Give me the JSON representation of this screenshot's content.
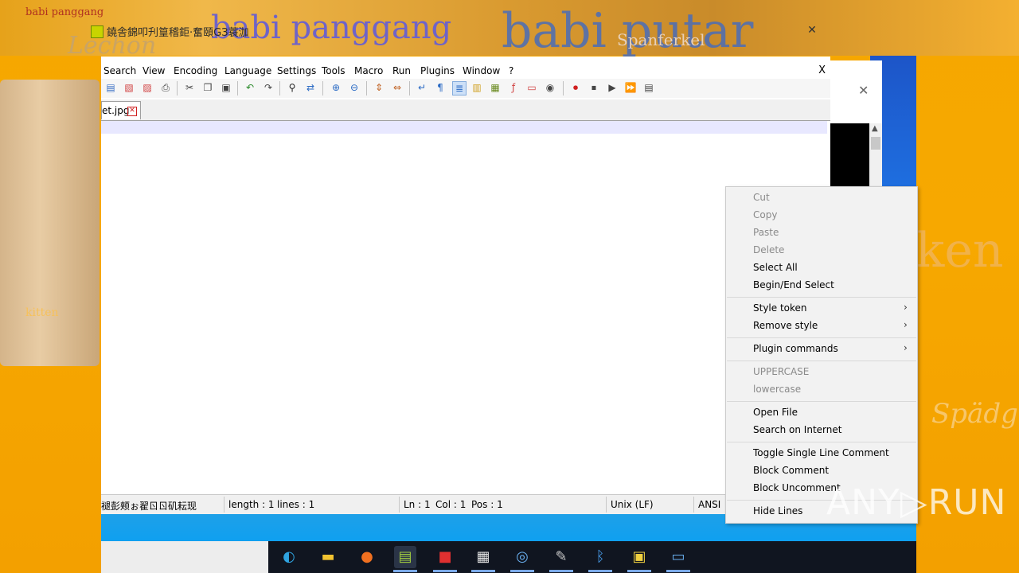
{
  "background": {
    "words": [
      "babi panggang",
      "babi putar",
      "Spanferkel",
      "babi panggang",
      "kitten",
      "Spädgris",
      "Lechon"
    ],
    "accent_color": "#f5a700"
  },
  "window": {
    "title": "鐃舎錦叩刋篁稽鉅·奮頤GЗ蓑泇",
    "close_glyph": "✕"
  },
  "menu": {
    "items": [
      "Search",
      "View",
      "Encoding",
      "Language",
      "Settings",
      "Tools",
      "Macro",
      "Run",
      "Plugins",
      "Window",
      "?"
    ],
    "close": "X"
  },
  "toolbar": {
    "icons": [
      "new-file-icon",
      "open-file-icon",
      "save-icon",
      "save-all-icon",
      "print-icon",
      "cut-icon",
      "copy-icon",
      "paste-icon",
      "undo-icon",
      "redo-icon",
      "find-icon",
      "replace-icon",
      "zoom-in-icon",
      "zoom-out-icon",
      "sync-v-icon",
      "sync-h-icon",
      "word-wrap-icon",
      "all-chars-icon",
      "indent-guide-icon",
      "udl-icon",
      "doc-map-icon",
      "function-list-icon",
      "folder-workspace-icon",
      "monitor-icon",
      "record-icon",
      "stop-icon",
      "play-icon",
      "run-multiple-icon",
      "save-macro-icon"
    ]
  },
  "tab": {
    "label": "et.jpg",
    "close_glyph": "✕"
  },
  "status": {
    "doc_type": "褪彭颊ぉ翟ㄖㄖ矶耘现",
    "length": "length : 1",
    "lines": "lines : 1",
    "ln": "Ln : 1",
    "col": "Col : 1",
    "pos": "Pos : 1",
    "eol": "Unix (LF)",
    "encoding": "ANSI"
  },
  "context_menu": {
    "cut": "Cut",
    "copy": "Copy",
    "paste": "Paste",
    "delete": "Delete",
    "select_all": "Select All",
    "begin_end_select": "Begin/End Select",
    "style_token": "Style token",
    "remove_style": "Remove style",
    "plugin_commands": "Plugin commands",
    "uppercase": "UPPERCASE",
    "lowercase": "lowercase",
    "open_file": "Open File",
    "search_on_internet": "Search on Internet",
    "toggle_comment": "Toggle Single Line Comment",
    "block_comment": "Block Comment",
    "block_uncomment": "Block Uncomment",
    "hide_lines": "Hide Lines",
    "submenu_arrow": "›"
  },
  "dialog": {
    "close_glyph": "✕"
  },
  "taskbar": {
    "apps": [
      "edge-icon",
      "file-explorer-icon",
      "firefox-icon",
      "notepadpp-icon",
      "app-red-icon",
      "news-icon",
      "network-icon",
      "paint-icon",
      "bluetooth-icon",
      "winrar-icon",
      "app-window-icon"
    ]
  },
  "watermark": "ANY▷RUN"
}
